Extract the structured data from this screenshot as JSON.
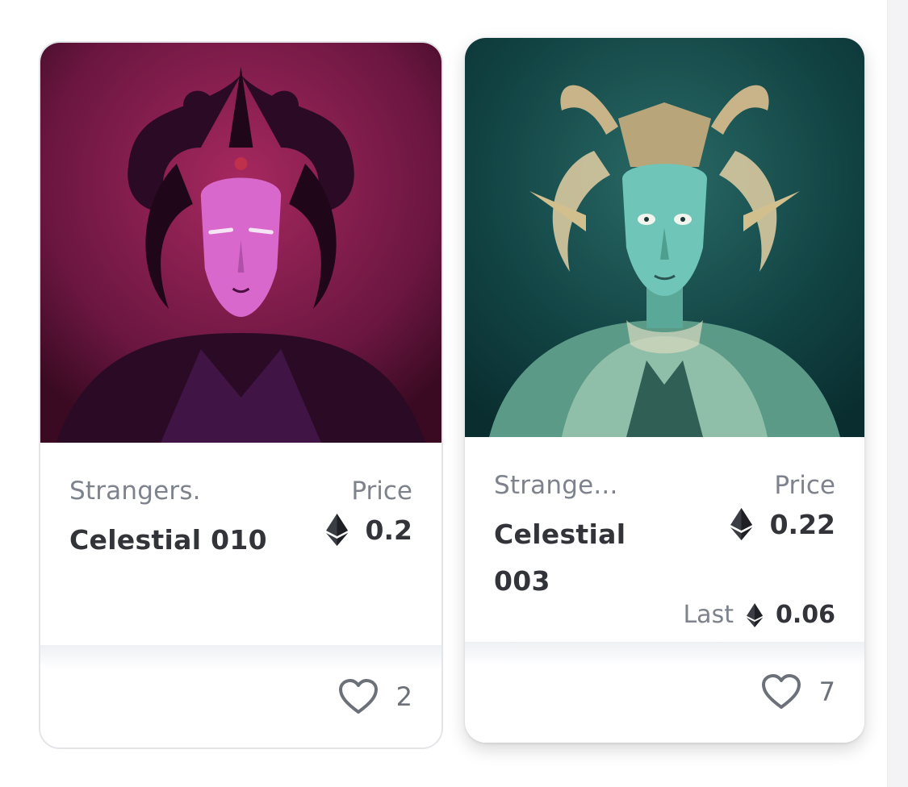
{
  "cards": [
    {
      "collection": "Strangers.",
      "name": "Celestial 010",
      "price_label": "Price",
      "price": "0.2",
      "likes": "2",
      "art_colors": {
        "bg": "#6a1640",
        "mid": "#a6285f",
        "face": "#d868cc",
        "hair": "#2a0a24"
      }
    },
    {
      "collection": "Strange...",
      "name": "Celestial 003",
      "price_label": "Price",
      "price": "0.22",
      "last_label": "Last",
      "last_price": "0.06",
      "likes": "7",
      "art_colors": {
        "bg": "#0f3f40",
        "mid": "#1f5a58",
        "face": "#6fc6b8",
        "ornament": "#c9b48a"
      }
    }
  ],
  "icons": {
    "currency": "ethereum-icon",
    "like": "heart-icon"
  }
}
